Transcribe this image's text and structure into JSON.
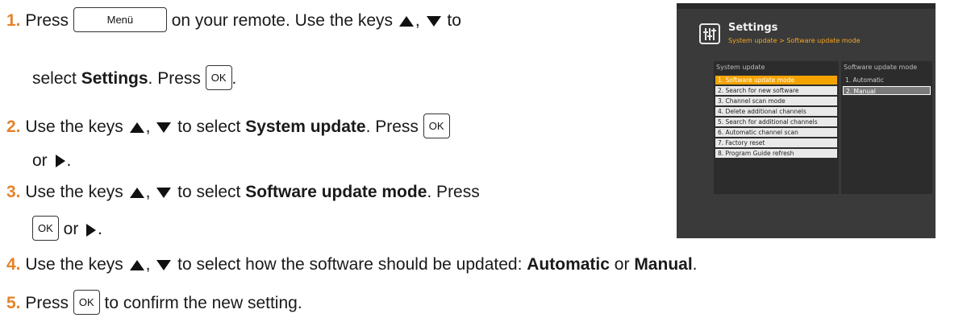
{
  "steps": [
    {
      "num": "1.",
      "t1": "Press",
      "key": "Menü",
      "t2": "on your remote. Use the keys",
      "t3": "to",
      "t4": "select",
      "t5": "Settings",
      "t6": ". Press",
      "ok": "OK",
      "t7": "."
    },
    {
      "num": "2.",
      "t1": "Use the keys",
      "t2": ",",
      "t3": "to select",
      "t4": "System update",
      "t5": ". Press",
      "ok": "OK",
      "t6": "or",
      "t7": "."
    },
    {
      "num": "3.",
      "t1": "Use the keys",
      "t2": ",",
      "t3": "to select",
      "t4": "Software update mode",
      "t5": ". Press",
      "ok": "OK",
      "t6": "or",
      "t7": "."
    },
    {
      "num": "4.",
      "t1": "Use the keys",
      "t2": ",",
      "t3": "to select how the software should be updated:",
      "t4": "Automatic",
      "t5": "or",
      "t6": "Manual",
      "t7": "."
    },
    {
      "num": "5.",
      "t1": "Press",
      "ok": "OK",
      "t2": "to confirm the new setting."
    }
  ],
  "tv": {
    "title": "Settings",
    "breadcrumb": "System update > Software update mode",
    "left_header": "System update",
    "right_header": "Software update mode",
    "left_items": [
      "1. Software update mode",
      "2. Search for new software",
      "3. Channel scan mode",
      "4. Delete additional channels",
      "5. Search for additional channels",
      "6. Automatic channel scan",
      "7. Factory reset",
      "8. Program Guide refresh"
    ],
    "right_items": [
      "1. Automatic",
      "2. Manual"
    ]
  }
}
